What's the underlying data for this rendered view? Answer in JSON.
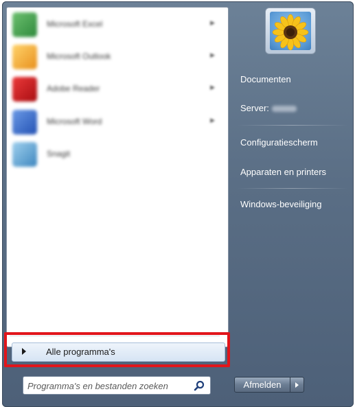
{
  "start_menu": {
    "programs": [
      {
        "label": "Microsoft Excel",
        "icon": "excel-icon",
        "color": "#3f9b4a",
        "has_arrow": true
      },
      {
        "label": "Microsoft Outlook",
        "icon": "outlook-icon",
        "color": "#f0a12a",
        "has_arrow": true
      },
      {
        "label": "Adobe Reader",
        "icon": "adobe-reader-icon",
        "color": "#c8141b",
        "has_arrow": true
      },
      {
        "label": "Microsoft Word",
        "icon": "word-icon",
        "color": "#2f63c4",
        "has_arrow": true
      },
      {
        "label": "Snagit",
        "icon": "snagit-icon",
        "color": "#5fa3d0",
        "has_arrow": false
      }
    ],
    "all_programs_label": "Alle programma's",
    "search_placeholder": "Programma's en bestanden zoeken",
    "right_links": {
      "documents": "Documenten",
      "server": "Server:",
      "control_panel": "Configuratiescherm",
      "devices": "Apparaten en printers",
      "security": "Windows-beveiliging"
    },
    "shutdown_label": "Afmelden",
    "highlight_color": "#e1151b"
  }
}
